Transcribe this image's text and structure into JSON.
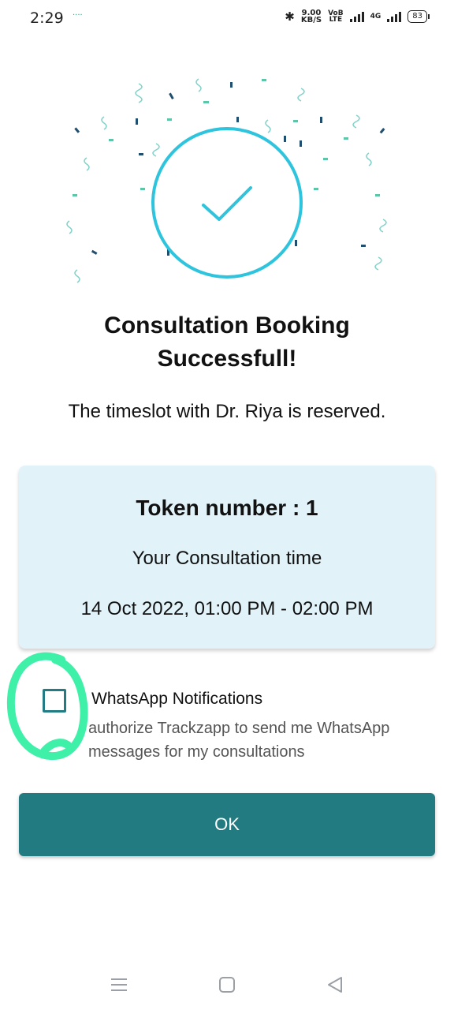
{
  "status_bar": {
    "time": "2:29",
    "dots": "····",
    "net_speed_value": "9.00",
    "net_speed_unit": "KB/S",
    "volte_top": "VoB",
    "volte_bottom": "LTE",
    "network_type": "4G",
    "battery": "83"
  },
  "booking": {
    "title_line1": "Consultation Booking",
    "title_line2": "Successfull!",
    "subtitle": "The timeslot with Dr. Riya is reserved."
  },
  "token_card": {
    "token": "Token number : 1",
    "consult_label": "Your Consultation time",
    "consult_time": "14 Oct 2022, 01:00 PM - 02:00 PM"
  },
  "whatsapp": {
    "title": "WhatsApp Notifications",
    "description": "authorize Trackzapp to send me WhatsApp messages for my consultations",
    "checked": false
  },
  "actions": {
    "ok_label": "OK"
  },
  "colors": {
    "accent": "#217b80",
    "circle": "#2ec4dd",
    "card_bg": "#e1f3f9",
    "highlight": "#3ef0a8"
  }
}
